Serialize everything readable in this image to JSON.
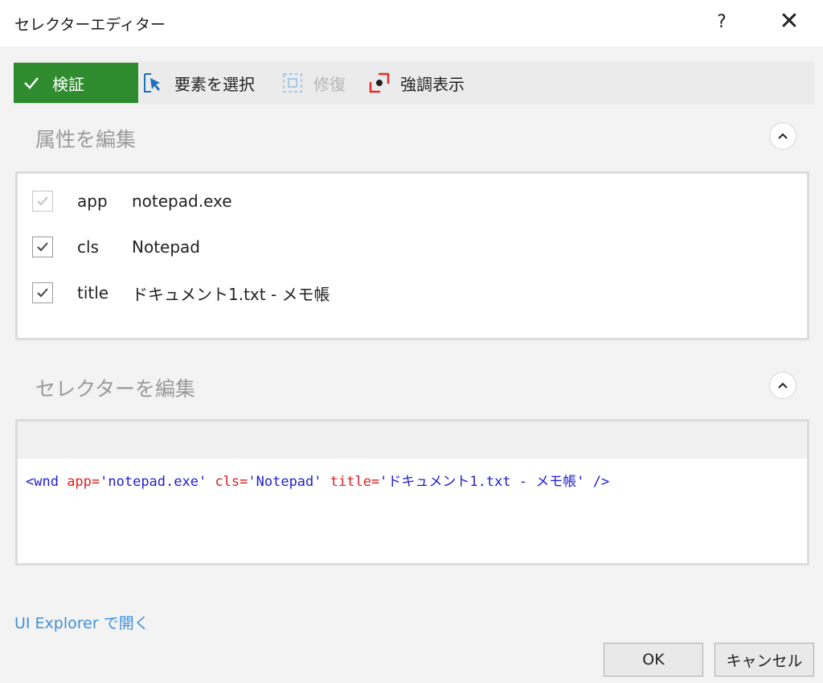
{
  "window": {
    "title": "セレクターエディター",
    "help_label": "?",
    "close_label": "✕"
  },
  "toolbar": {
    "validate_label": "検証",
    "select_element_label": "要素を選択",
    "repair_label": "修復",
    "highlight_label": "強調表示"
  },
  "attributes_section": {
    "title": "属性を編集",
    "rows": [
      {
        "key": "app",
        "value": "notepad.exe",
        "checked": true,
        "disabled": true
      },
      {
        "key": "cls",
        "value": "Notepad",
        "checked": true,
        "disabled": false
      },
      {
        "key": "title",
        "value": "ドキュメント1.txt - メモ帳",
        "checked": true,
        "disabled": false
      }
    ]
  },
  "selector_section": {
    "title": "セレクターを編集",
    "code": {
      "open": "<wnd ",
      "attr1": "app=",
      "val1": "'notepad.exe' ",
      "attr2": "cls=",
      "val2": "'Notepad' ",
      "attr3": "title=",
      "val3": "'ドキュメント1.txt - メモ帳' ",
      "close": "/>"
    }
  },
  "footer": {
    "explorer_link": "UI Explorer で開く",
    "ok_label": "OK",
    "cancel_label": "キャンセル"
  },
  "colors": {
    "validate_green": "#2e8b2e",
    "code_tag": "#1f1fd0",
    "code_attr": "#e02020",
    "link": "#3f8fd8"
  }
}
